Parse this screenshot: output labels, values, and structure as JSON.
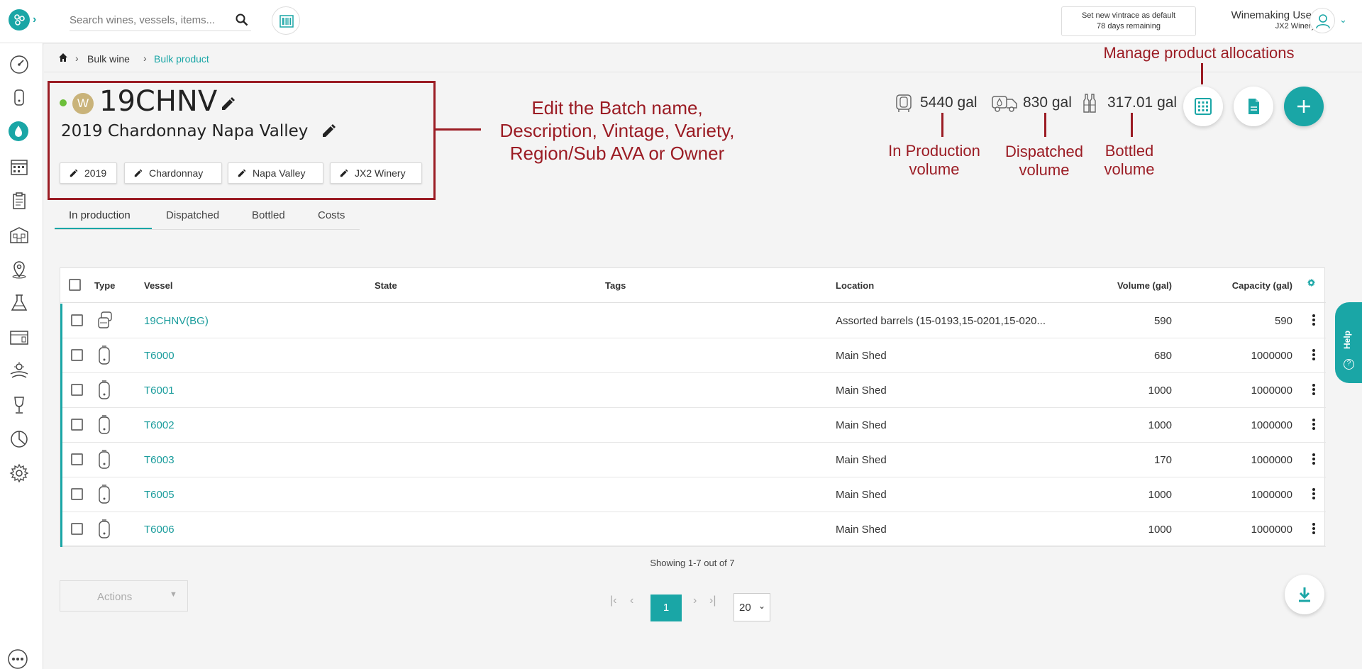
{
  "header": {
    "search_placeholder": "Search wines, vessels, items...",
    "vintrace_line1": "Set new vintrace as default",
    "vintrace_line2": "78 days remaining",
    "user_name": "Winemaking User",
    "user_org": "JX2 Winery"
  },
  "breadcrumb": {
    "items": [
      "Bulk wine",
      "Bulk product"
    ]
  },
  "batch": {
    "badge": "W",
    "name": "19CHNV",
    "description": "2019 Chardonnay Napa Valley",
    "chips": [
      "2019",
      "Chardonnay",
      "Napa Valley",
      "JX2 Winery"
    ]
  },
  "volumes": {
    "in_production": "5440 gal",
    "dispatched": "830 gal",
    "bottled": "317.01 gal"
  },
  "annotations": {
    "edit_line1": "Edit the Batch name,",
    "edit_line2": "Description, Vintage, Variety,",
    "edit_line3": "Region/Sub AVA or Owner",
    "manage": "Manage product allocations",
    "inprod_1": "In Production",
    "inprod_2": "volume",
    "disp_1": "Dispatched",
    "disp_2": "volume",
    "bot_1": "Bottled",
    "bot_2": "volume"
  },
  "tabs": [
    "In production",
    "Dispatched",
    "Bottled",
    "Costs"
  ],
  "table": {
    "headers": {
      "type": "Type",
      "vessel": "Vessel",
      "state": "State",
      "tags": "Tags",
      "location": "Location",
      "volume": "Volume (gal)",
      "capacity": "Capacity (gal)"
    },
    "rows": [
      {
        "vessel": "19CHNV(BG)",
        "location": "Assorted barrels (15-0193,15-0201,15-020...",
        "volume": "590",
        "capacity": "590",
        "type_icon": "barrel-group-icon"
      },
      {
        "vessel": "T6000",
        "location": "Main Shed",
        "volume": "680",
        "capacity": "1000000",
        "type_icon": "tank-icon"
      },
      {
        "vessel": "T6001",
        "location": "Main Shed",
        "volume": "1000",
        "capacity": "1000000",
        "type_icon": "tank-icon"
      },
      {
        "vessel": "T6002",
        "location": "Main Shed",
        "volume": "1000",
        "capacity": "1000000",
        "type_icon": "tank-icon"
      },
      {
        "vessel": "T6003",
        "location": "Main Shed",
        "volume": "170",
        "capacity": "1000000",
        "type_icon": "tank-icon"
      },
      {
        "vessel": "T6005",
        "location": "Main Shed",
        "volume": "1000",
        "capacity": "1000000",
        "type_icon": "tank-icon"
      },
      {
        "vessel": "T6006",
        "location": "Main Shed",
        "volume": "1000",
        "capacity": "1000000",
        "type_icon": "tank-icon"
      }
    ]
  },
  "footer": {
    "showing": "Showing 1-7 out of 7",
    "actions_label": "Actions",
    "current_page": "1",
    "page_size": "20",
    "help_label": "Help",
    "side_foot": "← + ?"
  },
  "colors": {
    "accent": "#1aa6a6",
    "annotation": "#9b1c24",
    "status_green": "#6cbf3a",
    "badge": "#c9b37a"
  }
}
